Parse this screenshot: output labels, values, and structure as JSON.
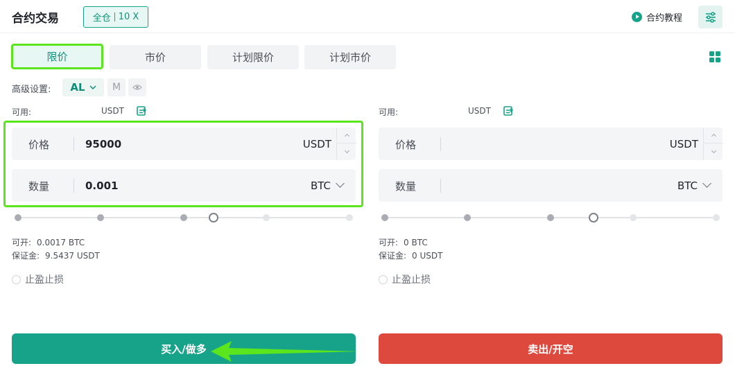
{
  "header": {
    "title": "合约交易",
    "margin_mode": "全仓",
    "leverage": "10 X",
    "tutorial_label": "合约教程"
  },
  "order_tabs": [
    {
      "label": "限价",
      "active": true
    },
    {
      "label": "市价",
      "active": false
    },
    {
      "label": "计划限价",
      "active": false
    },
    {
      "label": "计划市价",
      "active": false
    }
  ],
  "advanced": {
    "label": "高级设置:",
    "al_label": "AL",
    "m_label": "M"
  },
  "buy_panel": {
    "available_label": "可用:",
    "available_unit": "USDT",
    "price_label": "价格",
    "price_value": "95000",
    "price_unit": "USDT",
    "qty_label": "数量",
    "qty_value": "0.001",
    "qty_unit": "BTC",
    "slider_fraction": 0.6,
    "open_label": "可开:",
    "open_value": "0.0017 BTC",
    "margin_label": "保证金:",
    "margin_value": "9.5437 USDT",
    "tp_sl_label": "止盈止损",
    "action_label": "买入/做多"
  },
  "sell_panel": {
    "available_label": "可用:",
    "available_unit": "USDT",
    "price_label": "价格",
    "price_value": "",
    "price_unit": "USDT",
    "qty_label": "数量",
    "qty_value": "",
    "qty_unit": "BTC",
    "slider_fraction": 0.6,
    "open_label": "可开:",
    "open_value": "0 BTC",
    "margin_label": "保证金:",
    "margin_value": "0 USDT",
    "tp_sl_label": "止盈止损",
    "action_label": "卖出/开空"
  },
  "colors": {
    "accent": "#17a38a",
    "sell": "#dd4a3d",
    "highlight": "#5ae51d"
  }
}
